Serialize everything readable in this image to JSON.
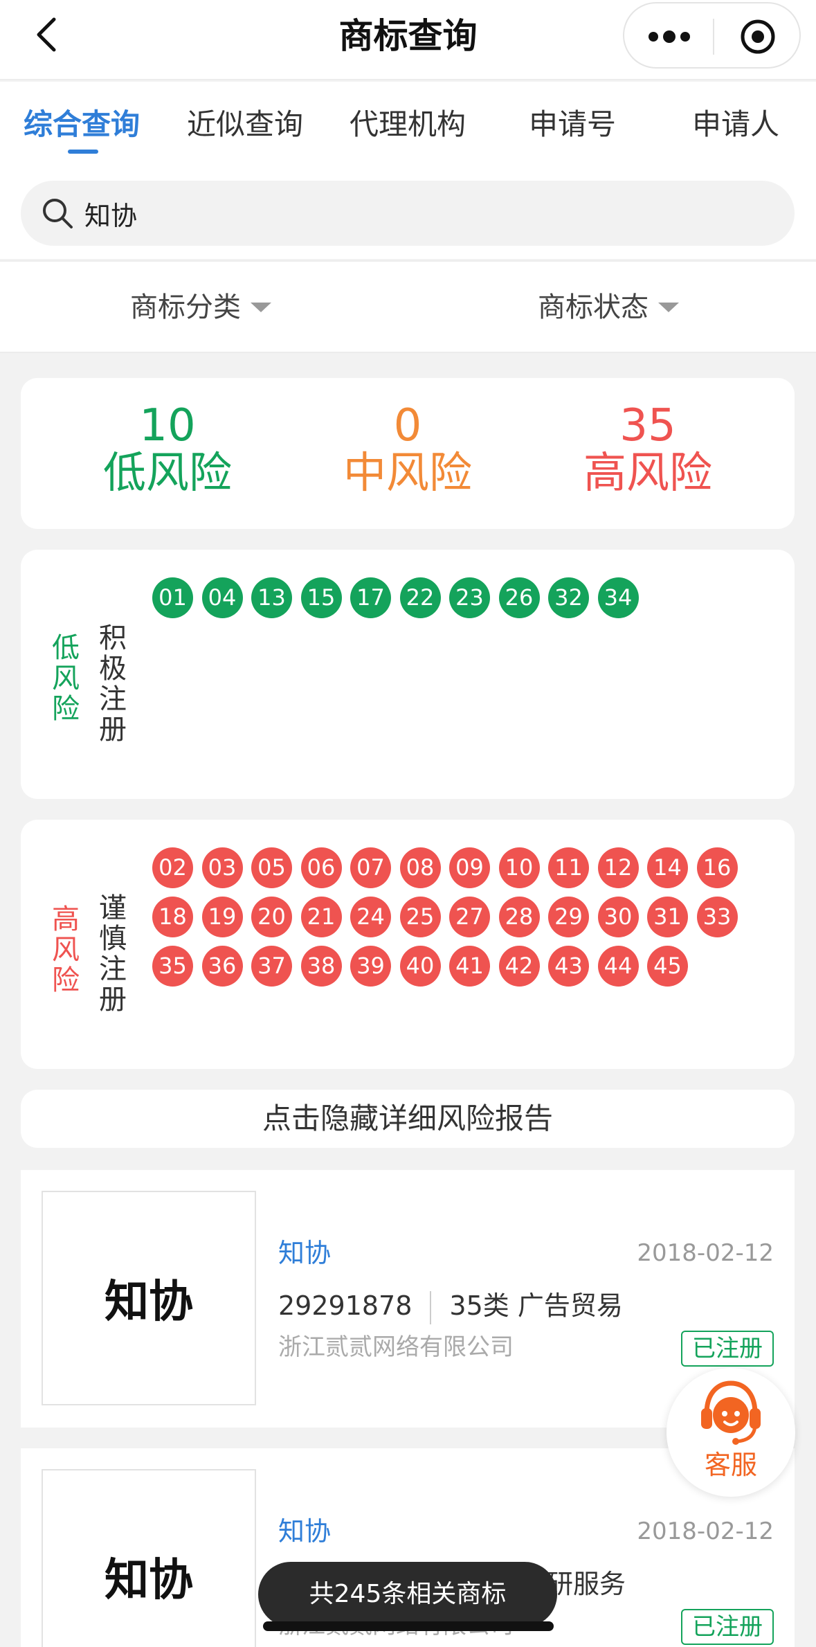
{
  "header": {
    "title": "商标查询",
    "icons": {
      "back": "chevron-left-icon",
      "more": "more-dots-icon",
      "close": "target-close-icon"
    }
  },
  "tabs": [
    {
      "label": "综合查询",
      "active": true
    },
    {
      "label": "近似查询",
      "active": false
    },
    {
      "label": "代理机构",
      "active": false
    },
    {
      "label": "申请号",
      "active": false
    },
    {
      "label": "申请人",
      "active": false
    }
  ],
  "search": {
    "value": "知协",
    "icon": "search-icon"
  },
  "filters": {
    "category": "商标分类",
    "status": "商标状态"
  },
  "summary": {
    "low": {
      "count": "10",
      "label": "低风险",
      "color": "#14a35b"
    },
    "mid": {
      "count": "0",
      "label": "中风险",
      "color": "#f28a37"
    },
    "high": {
      "count": "35",
      "label": "高风险",
      "color": "#ef5350"
    }
  },
  "low_panel": {
    "risk_label": "低风险",
    "advice": "积极注册",
    "classes": [
      "01",
      "04",
      "13",
      "15",
      "17",
      "22",
      "23",
      "26",
      "32",
      "34"
    ]
  },
  "high_panel": {
    "risk_label": "高风险",
    "advice": "谨慎注册",
    "classes": [
      "02",
      "03",
      "05",
      "06",
      "07",
      "08",
      "09",
      "10",
      "11",
      "12",
      "14",
      "16",
      "18",
      "19",
      "20",
      "21",
      "24",
      "25",
      "27",
      "28",
      "29",
      "30",
      "31",
      "33",
      "35",
      "36",
      "37",
      "38",
      "39",
      "40",
      "41",
      "42",
      "43",
      "44",
      "45"
    ]
  },
  "toggle_report": "点击隐藏详细风险报告",
  "results": [
    {
      "logo_text": "知协",
      "name": "知协",
      "date": "2018-02-12",
      "reg_no": "29291878",
      "class_info": "35类 广告贸易",
      "company": "浙江贰贰网络有限公司",
      "status": "已注册"
    },
    {
      "logo_text": "知协",
      "name": "知协",
      "date": "2018-02-12",
      "class_info": "研服务",
      "company": "浙江贰贰网络有限公司",
      "status": "已注册"
    }
  ],
  "kefu": {
    "label": "客服",
    "icon": "customer-service-headset-icon"
  },
  "toast": "共245条相关商标"
}
